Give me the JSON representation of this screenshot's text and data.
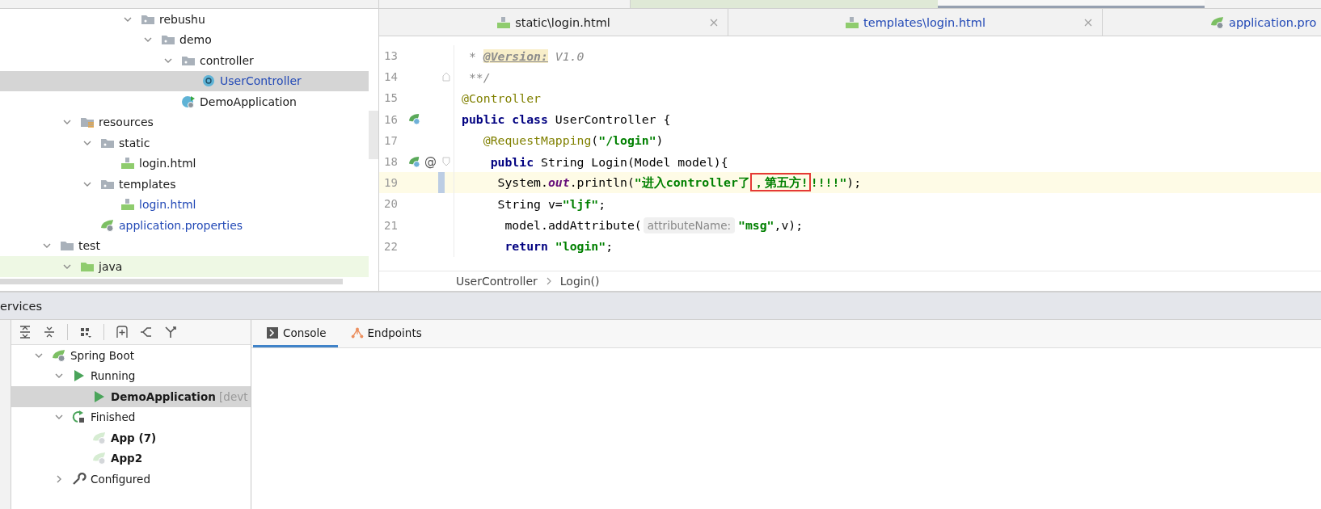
{
  "project_tree": {
    "items": [
      {
        "children": [
          {
            "children": [
              {
                "children": [
                  {
                    "children": [
                      {
                        "label": "rebushu",
                        "kind": "package",
                        "expanded": true,
                        "selected": false,
                        "changed": false,
                        "children": [
                          {
                            "label": "demo",
                            "kind": "package",
                            "expanded": true,
                            "selected": false,
                            "changed": false,
                            "children": [
                              {
                                "label": "controller",
                                "kind": "package",
                                "expanded": true,
                                "selected": false,
                                "changed": false,
                                "children": [
                                  {
                                    "label": "UserController",
                                    "kind": "class",
                                    "selected": true,
                                    "changed": true
                                  }
                                ]
                              },
                              {
                                "label": "DemoApplication",
                                "kind": "spring-class",
                                "selected": false,
                                "changed": false
                              }
                            ]
                          }
                        ]
                      }
                    ]
                  }
                ]
              }
            ]
          },
          {
            "label": "resources",
            "kind": "resources-folder",
            "expanded": true,
            "selected": false,
            "changed": false,
            "children": [
              {
                "label": "static",
                "kind": "package",
                "expanded": true,
                "selected": false,
                "changed": false,
                "children": [
                  {
                    "label": "login.html",
                    "kind": "html",
                    "selected": false,
                    "changed": false
                  }
                ]
              },
              {
                "label": "templates",
                "kind": "package",
                "expanded": true,
                "selected": false,
                "changed": false,
                "children": [
                  {
                    "label": "login.html",
                    "kind": "html",
                    "selected": false,
                    "changed": true
                  }
                ]
              },
              {
                "label": "application.properties",
                "kind": "properties",
                "selected": false,
                "changed": true
              }
            ]
          }
        ]
      },
      {
        "label": "test",
        "kind": "folder",
        "expanded": true,
        "selected": false,
        "changed": false,
        "children": [
          {
            "label": "java",
            "kind": "test-root",
            "expanded": true,
            "selected": false,
            "changed": false
          }
        ]
      }
    ]
  },
  "editor": {
    "tabs": [
      {
        "label": "static\\login.html",
        "kind": "html",
        "changed": false,
        "closable": true
      },
      {
        "label": "templates\\login.html",
        "kind": "html",
        "changed": true,
        "closable": true
      },
      {
        "label": "application.pro",
        "kind": "properties",
        "changed": true,
        "closable": false
      }
    ],
    "lines": [
      {
        "number": "13",
        "current": false,
        "changed": false,
        "fold_start": false,
        "fold_end": false,
        "tokens": [
          {
            "t": " * ",
            "kind": "comment"
          },
          {
            "t": "@Version:",
            "kind": "doctag"
          },
          {
            "t": " V1.0",
            "kind": "comment"
          }
        ]
      },
      {
        "number": "14",
        "current": false,
        "changed": false,
        "fold_start": false,
        "fold_end": true,
        "tokens": [
          {
            "t": " **/",
            "kind": "comment"
          }
        ]
      },
      {
        "number": "15",
        "current": false,
        "changed": false,
        "fold_start": false,
        "fold_end": false,
        "tokens": [
          {
            "t": "@Controller",
            "kind": "annotation"
          }
        ]
      },
      {
        "number": "16",
        "current": false,
        "changed": false,
        "fold_start": false,
        "fold_end": false,
        "gutter": [
          {
            "kind": "bean"
          }
        ],
        "tokens": [
          {
            "t": "public class",
            "kind": "keyword"
          },
          {
            "t": " UserController {",
            "kind": "plain"
          }
        ]
      },
      {
        "number": "17",
        "current": false,
        "changed": false,
        "fold_start": false,
        "fold_end": false,
        "tokens": [
          {
            "t": "   @RequestMapping",
            "kind": "annotation"
          },
          {
            "t": "(",
            "kind": "plain"
          },
          {
            "t": "\"/login\"",
            "kind": "string"
          },
          {
            "t": ")",
            "kind": "plain"
          }
        ]
      },
      {
        "number": "18",
        "current": false,
        "changed": false,
        "fold_start": true,
        "fold_end": false,
        "gutter": [
          {
            "kind": "bean"
          },
          {
            "kind": "mapping",
            "text": "@"
          }
        ],
        "tokens": [
          {
            "t": "    public",
            "kind": "keyword"
          },
          {
            "t": " String Login(Model model){",
            "kind": "plain"
          }
        ]
      },
      {
        "number": "19",
        "current": true,
        "changed": true,
        "fold_start": false,
        "fold_end": false,
        "tokens": [
          {
            "t": "     System.",
            "kind": "plain"
          },
          {
            "t": "out",
            "kind": "field"
          },
          {
            "t": ".println(",
            "kind": "plain"
          },
          {
            "t": "\"进入controller了",
            "kind": "string"
          },
          {
            "t": "，第五方!",
            "kind": "string",
            "boxed": true
          },
          {
            "t": "!!!!\"",
            "kind": "string"
          },
          {
            "t": ");",
            "kind": "plain"
          }
        ]
      },
      {
        "number": "20",
        "current": false,
        "changed": false,
        "fold_start": false,
        "fold_end": false,
        "tokens": [
          {
            "t": "     String v=",
            "kind": "plain"
          },
          {
            "t": "\"ljf\"",
            "kind": "string"
          },
          {
            "t": ";",
            "kind": "plain"
          }
        ]
      },
      {
        "number": "21",
        "current": false,
        "changed": false,
        "fold_start": false,
        "fold_end": false,
        "tokens": [
          {
            "t": "      model.addAttribute(",
            "kind": "plain"
          },
          {
            "t": "attributeName:",
            "kind": "hint"
          },
          {
            "t": "\"msg\"",
            "kind": "string"
          },
          {
            "t": ",v);",
            "kind": "plain"
          }
        ]
      },
      {
        "number": "22",
        "current": false,
        "changed": false,
        "fold_start": false,
        "fold_end": false,
        "tokens": [
          {
            "t": "      return",
            "kind": "keyword"
          },
          {
            "t": " \"login\"",
            "kind": "string"
          },
          {
            "t": ";",
            "kind": "plain"
          }
        ]
      }
    ],
    "breadcrumb": [
      "UserController",
      "Login()"
    ]
  },
  "services": {
    "title": "ervices",
    "tree": [
      {
        "label": "Spring Boot",
        "kind": "spring-boot",
        "expanded": true,
        "selected": false,
        "children": [
          {
            "label": "Running",
            "kind": "running",
            "expanded": true,
            "selected": false,
            "children": [
              {
                "label": "DemoApplication",
                "detail": "[devt",
                "kind": "running-app",
                "selected": true
              }
            ]
          },
          {
            "label": "Finished",
            "kind": "finished",
            "expanded": true,
            "selected": false,
            "children": [
              {
                "label": "App (7)",
                "kind": "finished-app",
                "selected": false
              },
              {
                "label": "App2",
                "kind": "finished-app",
                "selected": false
              }
            ]
          },
          {
            "label": "Configured",
            "kind": "configured",
            "expanded": false,
            "selected": false
          }
        ]
      }
    ],
    "tabs": [
      {
        "label": "Console",
        "kind": "console",
        "selected": true
      },
      {
        "label": "Endpoints",
        "kind": "endpoints",
        "selected": false
      }
    ]
  }
}
